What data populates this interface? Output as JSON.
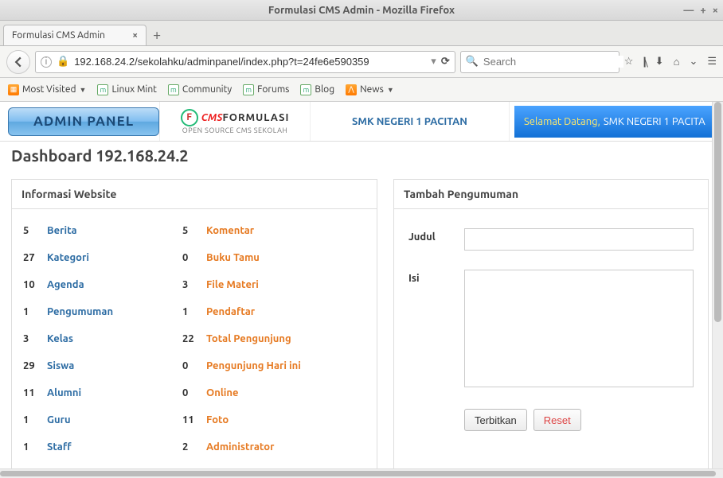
{
  "window": {
    "title": "Formulasi CMS Admin - Mozilla Firefox"
  },
  "tab": {
    "title": "Formulasi CMS Admin"
  },
  "url": {
    "value": "192.168.24.2/sekolahku/adminpanel/index.php?t=24fe6e590359"
  },
  "search": {
    "placeholder": "Search"
  },
  "bookmarks": {
    "most_visited": "Most Visited",
    "linux_mint": "Linux Mint",
    "community": "Community",
    "forums": "Forums",
    "blog": "Blog",
    "news": "News"
  },
  "header": {
    "admin_panel": "ADMIN PANEL",
    "logo_cms": "CMS",
    "logo_form": "FORMULASI",
    "logo_sub": "OPEN SOURCE CMS SEKOLAH",
    "school": "SMK NEGERI 1 PACITAN",
    "welcome1": "Selamat Datang,",
    "welcome2": "SMK NEGERI 1 PACITA"
  },
  "dashboard": {
    "title": "Dashboard 192.168.24.2"
  },
  "panels": {
    "info_title": "Informasi Website",
    "announce_title": "Tambah Pengumuman"
  },
  "info": {
    "items": [
      {
        "n1": "5",
        "l1": "Berita",
        "n2": "5",
        "l2": "Komentar"
      },
      {
        "n1": "27",
        "l1": "Kategori",
        "n2": "0",
        "l2": "Buku Tamu"
      },
      {
        "n1": "10",
        "l1": "Agenda",
        "n2": "3",
        "l2": "File Materi"
      },
      {
        "n1": "1",
        "l1": "Pengumuman",
        "n2": "1",
        "l2": "Pendaftar"
      },
      {
        "n1": "3",
        "l1": "Kelas",
        "n2": "22",
        "l2": "Total Pengunjung"
      },
      {
        "n1": "29",
        "l1": "Siswa",
        "n2": "0",
        "l2": "Pengunjung Hari ini"
      },
      {
        "n1": "11",
        "l1": "Alumni",
        "n2": "0",
        "l2": "Online"
      },
      {
        "n1": "1",
        "l1": "Guru",
        "n2": "11",
        "l2": "Foto"
      },
      {
        "n1": "1",
        "l1": "Staff",
        "n2": "2",
        "l2": "Administrator"
      }
    ]
  },
  "form": {
    "judul_label": "Judul",
    "isi_label": "Isi",
    "publish": "Terbitkan",
    "reset": "Reset"
  }
}
